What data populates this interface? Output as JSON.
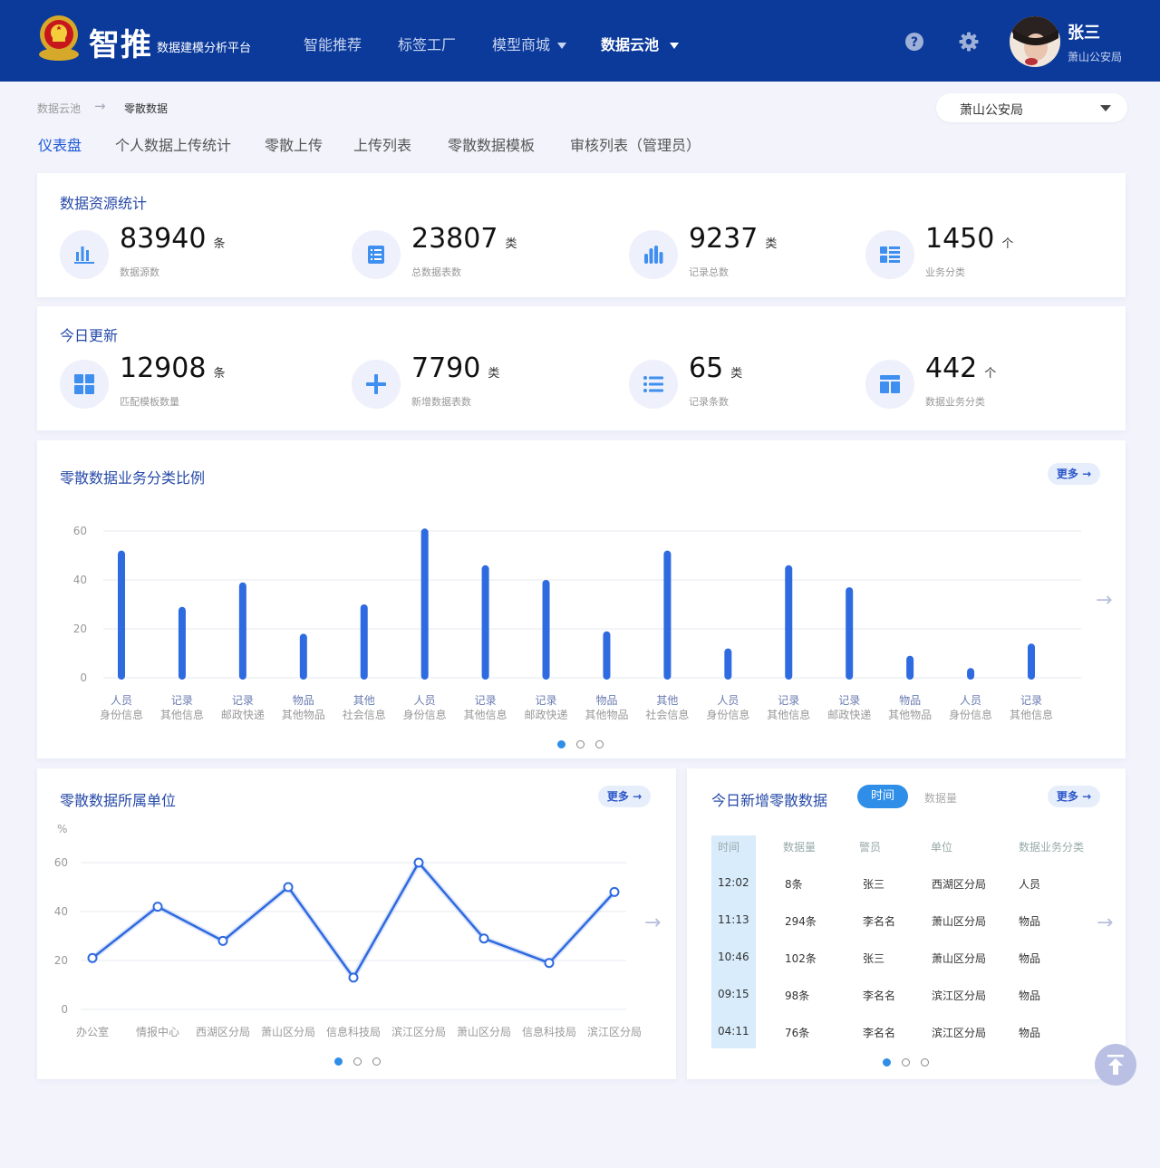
{
  "header": {
    "title": "智推",
    "subtitle": "数据建模分析平台",
    "nav": [
      {
        "label": "智能推荐",
        "active": false,
        "dropdown": false
      },
      {
        "label": "标签工厂",
        "active": false,
        "dropdown": false
      },
      {
        "label": "模型商城",
        "active": false,
        "dropdown": true
      },
      {
        "label": "数据云池",
        "active": true,
        "dropdown": true
      }
    ],
    "icons": [
      "help-icon",
      "gear-icon"
    ],
    "user": {
      "name": "张三",
      "org": "萧山公安局"
    },
    "colors": {
      "bg": "#0b3a9b",
      "accent": "#1e5ad6"
    }
  },
  "breadcrumb": {
    "parent": "数据云池",
    "current": "零散数据"
  },
  "org_select": {
    "value": "萧山公安局"
  },
  "tabs": [
    {
      "label": "仪表盘",
      "active": true
    },
    {
      "label": "个人数据上传统计",
      "active": false
    },
    {
      "label": "零散上传",
      "active": false
    },
    {
      "label": "上传列表",
      "active": false
    },
    {
      "label": "零散数据模板",
      "active": false
    },
    {
      "label": "审核列表（管理员）",
      "active": false
    }
  ],
  "resource_stats": {
    "title": "数据资源统计",
    "items": [
      {
        "value": "83940",
        "unit": "条",
        "label": "数据源数",
        "icon": "bar-chart-icon"
      },
      {
        "value": "23807",
        "unit": "类",
        "label": "总数据表数",
        "icon": "document-list-icon"
      },
      {
        "value": "9237",
        "unit": "类",
        "label": "记录总数",
        "icon": "column-chart-icon"
      },
      {
        "value": "1450",
        "unit": "个",
        "label": "业务分类",
        "icon": "category-list-icon"
      }
    ]
  },
  "today_update": {
    "title": "今日更新",
    "items": [
      {
        "value": "12908",
        "unit": "条",
        "label": "匹配模板数量",
        "icon": "grid-icon"
      },
      {
        "value": "7790",
        "unit": "类",
        "label": "新增数据表数",
        "icon": "plus-icon"
      },
      {
        "value": "65",
        "unit": "类",
        "label": "记录条数",
        "icon": "list-icon"
      },
      {
        "value": "442",
        "unit": "个",
        "label": "数据业务分类",
        "icon": "layout-icon"
      }
    ]
  },
  "bar_panel": {
    "title": "零散数据业务分类比例",
    "more": "更多"
  },
  "line_panel": {
    "title": "零散数据所属单位",
    "more": "更多"
  },
  "table_panel": {
    "title": "今日新增零散数据",
    "more": "更多",
    "toggle_active": "时间",
    "toggle_inactive": "数据量",
    "columns": [
      "时间",
      "数据量",
      "警员",
      "单位",
      "数据业务分类"
    ],
    "rows": [
      [
        "12:02",
        "8条",
        "张三",
        "西湖区分局",
        "人员"
      ],
      [
        "11:13",
        "294条",
        "李名名",
        "萧山区分局",
        "物品"
      ],
      [
        "10:46",
        "102条",
        "张三",
        "萧山区分局",
        "物品"
      ],
      [
        "09:15",
        "98条",
        "李名名",
        "滨江区分局",
        "物品"
      ],
      [
        "04:11",
        "76条",
        "李名名",
        "滨江区分局",
        "物品"
      ]
    ]
  },
  "chart_data": [
    {
      "type": "bar",
      "categories": [
        {
          "top": "人员",
          "bottom": "身份信息"
        },
        {
          "top": "记录",
          "bottom": "其他信息"
        },
        {
          "top": "记录",
          "bottom": "邮政快递"
        },
        {
          "top": "物品",
          "bottom": "其他物品"
        },
        {
          "top": "其他",
          "bottom": "社会信息"
        },
        {
          "top": "人员",
          "bottom": "身份信息"
        },
        {
          "top": "记录",
          "bottom": "其他信息"
        },
        {
          "top": "记录",
          "bottom": "邮政快递"
        },
        {
          "top": "物品",
          "bottom": "其他物品"
        },
        {
          "top": "其他",
          "bottom": "社会信息"
        },
        {
          "top": "人员",
          "bottom": "身份信息"
        },
        {
          "top": "记录",
          "bottom": "其他信息"
        },
        {
          "top": "记录",
          "bottom": "邮政快递"
        },
        {
          "top": "物品",
          "bottom": "其他物品"
        },
        {
          "top": "人员",
          "bottom": "身份信息"
        },
        {
          "top": "记录",
          "bottom": "其他信息"
        }
      ],
      "values": [
        52,
        29,
        39,
        18,
        30,
        61,
        46,
        40,
        19,
        52,
        12,
        46,
        37,
        9,
        4,
        14
      ],
      "yticks": [
        0,
        20,
        40,
        60
      ],
      "ylim": [
        0,
        60
      ],
      "grid": true,
      "color": "#2e6ae0"
    },
    {
      "type": "line",
      "categories": [
        "办公室",
        "情报中心",
        "西湖区分局",
        "萧山区分局",
        "信息科技局",
        "滨江区分局",
        "萧山区分局",
        "信息科技局",
        "滨江区分局"
      ],
      "values": [
        21,
        42,
        28,
        50,
        13,
        60,
        29,
        19,
        48
      ],
      "yunit": "%",
      "yticks": [
        0,
        20,
        40,
        60
      ],
      "ylim": [
        0,
        60
      ],
      "grid": true,
      "color": "#2e6ae0"
    }
  ],
  "pagination": {
    "pages": 3,
    "current": 1
  }
}
